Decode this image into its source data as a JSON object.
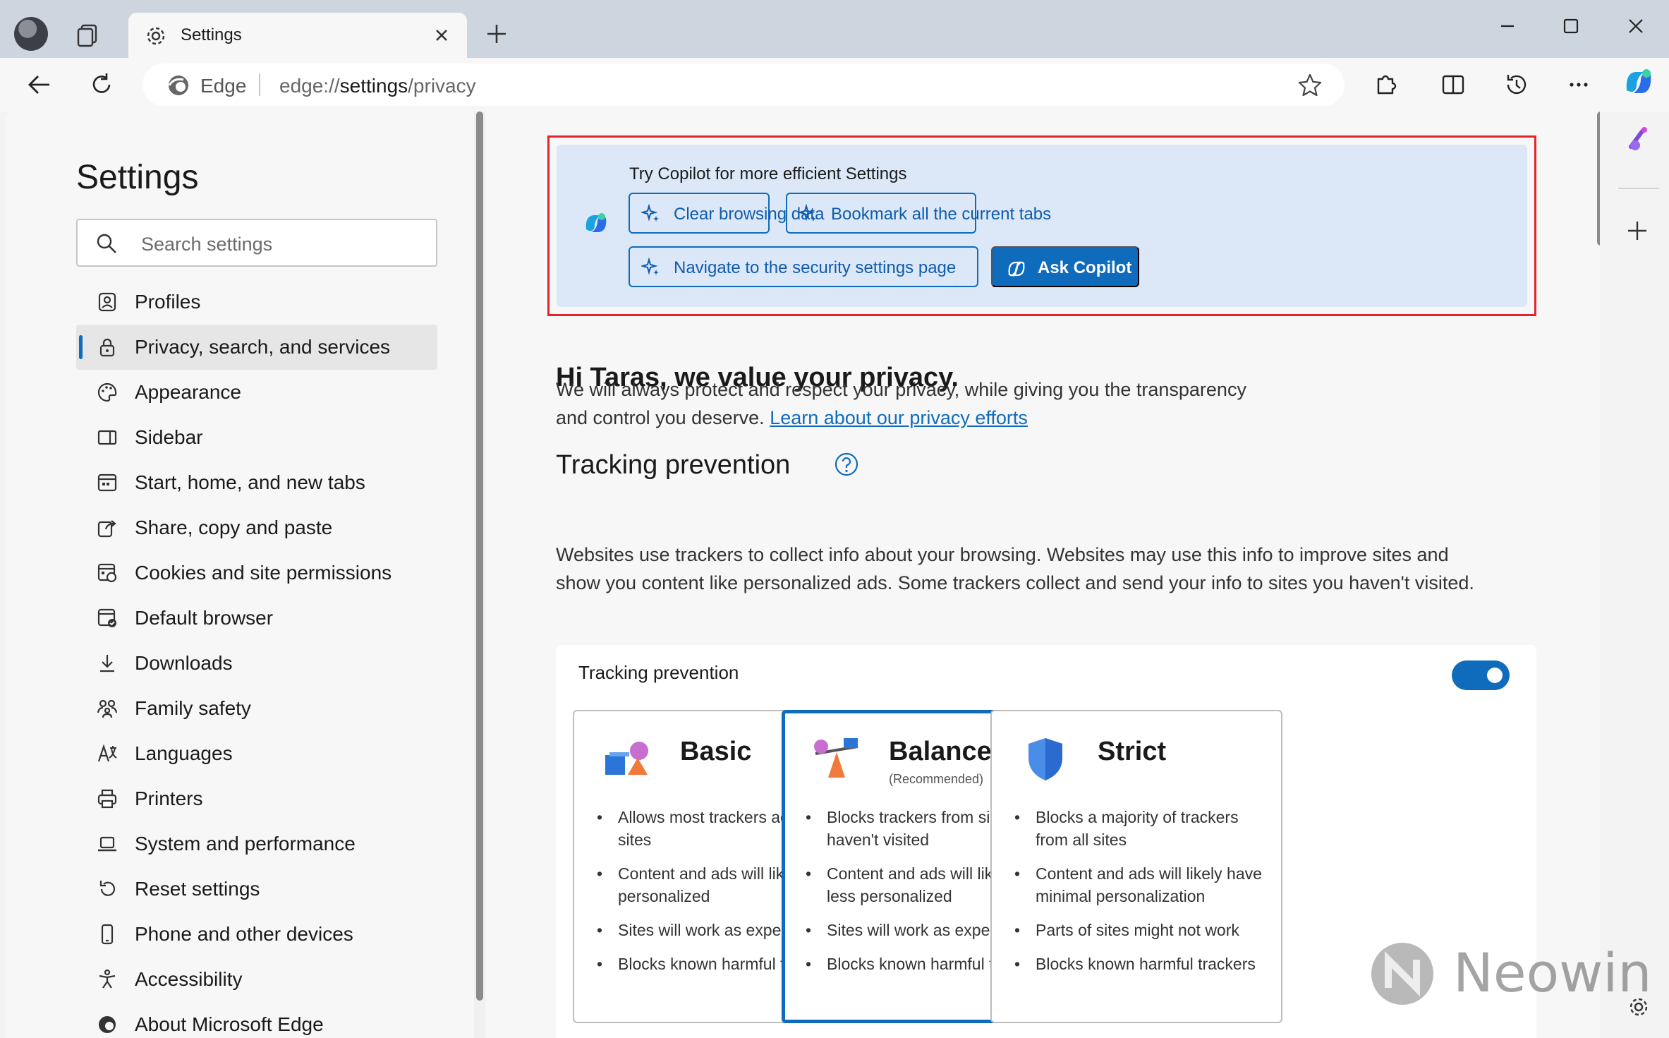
{
  "browser": {
    "tab_title": "Settings",
    "brand": "Edge",
    "url_prefix": "edge://",
    "url_host": "settings",
    "url_path": "/privacy"
  },
  "sidebar": {
    "title": "Settings",
    "search_placeholder": "Search settings",
    "items": [
      {
        "label": "Profiles",
        "icon": "profile-icon"
      },
      {
        "label": "Privacy, search, and services",
        "icon": "lock-icon",
        "active": true
      },
      {
        "label": "Appearance",
        "icon": "palette-icon"
      },
      {
        "label": "Sidebar",
        "icon": "sidebar-icon"
      },
      {
        "label": "Start, home, and new tabs",
        "icon": "home-tabs-icon"
      },
      {
        "label": "Share, copy and paste",
        "icon": "share-icon"
      },
      {
        "label": "Cookies and site permissions",
        "icon": "cookies-icon"
      },
      {
        "label": "Default browser",
        "icon": "default-browser-icon"
      },
      {
        "label": "Downloads",
        "icon": "download-icon"
      },
      {
        "label": "Family safety",
        "icon": "family-icon"
      },
      {
        "label": "Languages",
        "icon": "languages-icon"
      },
      {
        "label": "Printers",
        "icon": "printer-icon"
      },
      {
        "label": "System and performance",
        "icon": "laptop-icon"
      },
      {
        "label": "Reset settings",
        "icon": "reset-icon"
      },
      {
        "label": "Phone and other devices",
        "icon": "phone-icon"
      },
      {
        "label": "Accessibility",
        "icon": "accessibility-icon"
      },
      {
        "label": "About Microsoft Edge",
        "icon": "edge-icon"
      }
    ]
  },
  "copilot": {
    "heading": "Try Copilot for more efficient Settings",
    "chips": [
      "Clear browsing data",
      "Bookmark all the current tabs",
      "Navigate to the security settings page"
    ],
    "ask_label": "Ask Copilot"
  },
  "privacy": {
    "greeting": "Hi Taras, we value your privacy.",
    "intro_line1": "We will always protect and respect your privacy, while giving you the transparency",
    "intro_line2": "and control you deserve.",
    "learn_link": "Learn about our privacy efforts"
  },
  "tracking": {
    "heading": "Tracking prevention",
    "desc_line1": "Websites use trackers to collect info about your browsing. Websites may use this info to improve sites and",
    "desc_line2": "show you content like personalized ads. Some trackers collect and send your info to sites you haven't visited.",
    "card_label": "Tracking prevention",
    "enabled": true,
    "options": [
      {
        "name": "Basic",
        "sub": "",
        "selected": false,
        "bullets": [
          "Allows most trackers across all sites",
          "Content and ads will likely be personalized",
          "Sites will work as expected",
          "Blocks known harmful trackers"
        ]
      },
      {
        "name": "Balanced",
        "sub": "(Recommended)",
        "selected": true,
        "bullets": [
          "Blocks trackers from sites you haven't visited",
          "Content and ads will likely be less personalized",
          "Sites will work as expected",
          "Blocks known harmful trackers"
        ]
      },
      {
        "name": "Strict",
        "sub": "",
        "selected": false,
        "bullets": [
          "Blocks a majority of trackers from all sites",
          "Content and ads will likely have minimal personalization",
          "Parts of sites might not work",
          "Blocks known harmful trackers"
        ]
      }
    ]
  },
  "watermark": "Neowin",
  "colors": {
    "accent": "#0f6cbd",
    "highlight_border": "#e0262c",
    "copilot_bg": "#dce8f8"
  }
}
